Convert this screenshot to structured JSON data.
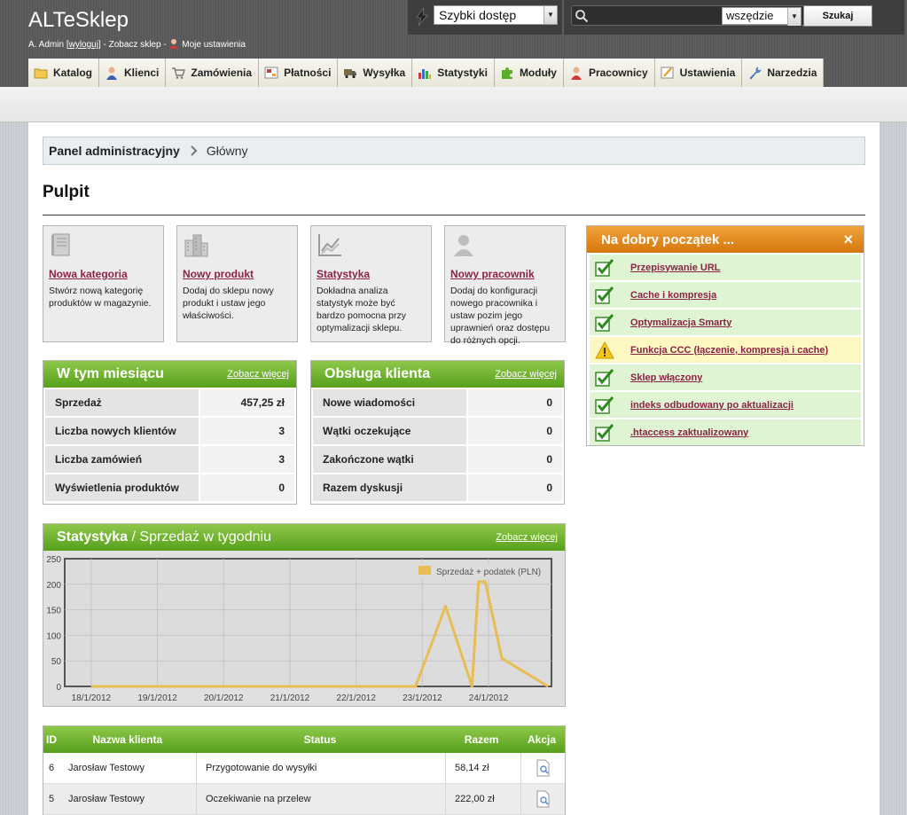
{
  "header": {
    "shop_title": "ALTeSklep",
    "user_name": "A. Admin",
    "bracket_open": "[",
    "logout": "wyloguj",
    "bracket_close": "]",
    "dash": "-",
    "view_shop": "Zobacz sklep",
    "my_settings": "Moje ustawienia",
    "quick_access": "Szybki dostęp",
    "search_scope": "wszędzie",
    "search_button": "Szukaj",
    "search_placeholder": ""
  },
  "nav": [
    {
      "label": "Katalog",
      "icon": "folder-icon"
    },
    {
      "label": "Klienci",
      "icon": "customers-icon"
    },
    {
      "label": "Zamówienia",
      "icon": "cart-icon"
    },
    {
      "label": "Płatności",
      "icon": "payment-icon"
    },
    {
      "label": "Wysyłka",
      "icon": "truck-icon"
    },
    {
      "label": "Statystyki",
      "icon": "stats-icon"
    },
    {
      "label": "Moduły",
      "icon": "puzzle-icon"
    },
    {
      "label": "Pracownicy",
      "icon": "employee-icon"
    },
    {
      "label": "Ustawienia",
      "icon": "settings-icon"
    },
    {
      "label": "Narzedzia",
      "icon": "wrench-icon"
    }
  ],
  "breadcrumb": {
    "parent": "Panel administracyjny",
    "current": "Główny"
  },
  "page_title": "Pulpit",
  "quick_links": [
    {
      "title": "Nowa kategoria",
      "desc": "Stwórz nową kategorię produktów w magazynie.",
      "icon": "book-icon"
    },
    {
      "title": "Nowy produkt",
      "desc": "Dodaj do sklepu nowy produkt i ustaw jego właściwości.",
      "icon": "buildings-icon"
    },
    {
      "title": "Statystyka",
      "desc": "Dokładna analiza statystyk może być bardzo pomocna przy optymalizacji sklepu.",
      "icon": "chart-icon"
    },
    {
      "title": "Nowy pracownik",
      "desc": "Dodaj do konfiguracji nowego pracownika i ustaw pozim jego uprawnień oraz dostępu do różnych opcji.",
      "icon": "user-icon"
    }
  ],
  "month_panel": {
    "title": "W tym miesiącu",
    "link": "Zobacz więcej",
    "rows": [
      {
        "label": "Sprzedaż",
        "value": "457,25 zł"
      },
      {
        "label": "Liczba nowych klientów",
        "value": "3"
      },
      {
        "label": "Liczba zamówień",
        "value": "3"
      },
      {
        "label": "Wyświetlenia produktów",
        "value": "0"
      }
    ]
  },
  "service_panel": {
    "title": "Obsługa klienta",
    "link": "Zobacz więcej",
    "rows": [
      {
        "label": "Nowe wiadomości",
        "value": "0"
      },
      {
        "label": "Wątki oczekujące",
        "value": "0"
      },
      {
        "label": "Zakończone wątki",
        "value": "0"
      },
      {
        "label": "Razem dyskusji",
        "value": "0"
      }
    ]
  },
  "stats_panel": {
    "title": "Statystyka",
    "slash": "/",
    "subtitle": "Sprzedaż w tygodniu",
    "link": "Zobacz więcej"
  },
  "chart_data": {
    "type": "line",
    "title": "",
    "xlabel": "",
    "ylabel": "",
    "ylim": [
      0,
      250
    ],
    "yticks": [
      0,
      50,
      100,
      150,
      200,
      250
    ],
    "xticks": [
      "18/1/2012",
      "19/1/2012",
      "20/1/2012",
      "21/1/2012",
      "22/1/2012",
      "23/1/2012",
      "24/1/2012"
    ],
    "x": [
      0,
      1,
      2,
      3,
      4,
      4.9,
      5.35,
      5.75,
      5.85,
      5.95,
      6.2,
      6.9
    ],
    "y": [
      0,
      0,
      0,
      0,
      0,
      0,
      157,
      0,
      205,
      205,
      55,
      0
    ],
    "series": [
      {
        "name": "Sprzedaż + podatek (PLN)",
        "color": "#e8bd52"
      }
    ],
    "legend": "top-right",
    "grid": true
  },
  "start_panel": {
    "title": "Na dobry początek ...",
    "close": "×",
    "items": [
      {
        "label": "Przepisywanie URL",
        "status": "ok"
      },
      {
        "label": "Cache i kompresja",
        "status": "ok"
      },
      {
        "label": "Optymalizacja Smarty",
        "status": "ok"
      },
      {
        "label": "Funkcja CCC (łączenie, kompresja i cache)",
        "status": "warn"
      },
      {
        "label": "Sklep włączony",
        "status": "ok"
      },
      {
        "label": "indeks odbudowany po aktualizacji",
        "status": "ok"
      },
      {
        "label": ".htaccess zaktualizowany",
        "status": "ok"
      }
    ]
  },
  "orders": {
    "headers": {
      "id": "ID",
      "name": "Nazwa klienta",
      "status": "Status",
      "total": "Razem",
      "action": "Akcja"
    },
    "rows": [
      {
        "id": "6",
        "name": "Jarosław Testowy",
        "status": "Przygotowanie do wysyłki",
        "total": "58,14 zł"
      },
      {
        "id": "5",
        "name": "Jarosław Testowy",
        "status": "Oczekiwanie na przelew",
        "total": "222,00 zł"
      }
    ]
  },
  "colors": {
    "green_header": "#6ab42a",
    "orange_header": "#e58c1e",
    "link": "#8b2346",
    "chart_line": "#e8bd52"
  }
}
